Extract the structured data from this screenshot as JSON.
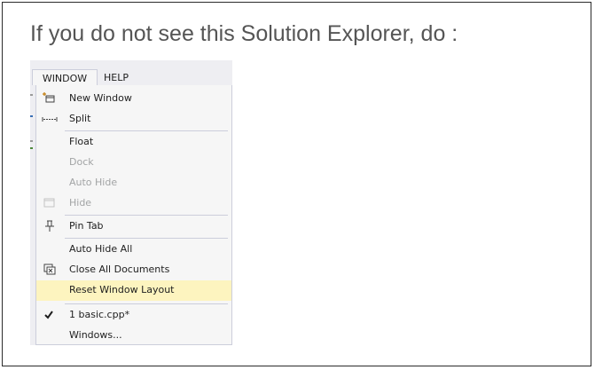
{
  "instruction": "If you do not see this Solution Explorer, do :",
  "menubar": {
    "window_label": "WINDOW",
    "help_label": "HELP"
  },
  "menu": {
    "items": [
      {
        "label": "New Window",
        "icon": "new-window-icon",
        "enabled": true
      },
      {
        "label": "Split",
        "icon": "split-icon",
        "enabled": true
      },
      {
        "label": "Float",
        "enabled": true
      },
      {
        "label": "Dock",
        "enabled": false
      },
      {
        "label": "Auto Hide",
        "enabled": false
      },
      {
        "label": "Hide",
        "icon": "hide-icon",
        "enabled": false
      },
      {
        "label": "Pin Tab",
        "icon": "pin-icon",
        "enabled": true
      },
      {
        "label": "Auto Hide All",
        "enabled": true
      },
      {
        "label": "Close All Documents",
        "icon": "close-all-documents-icon",
        "enabled": true
      },
      {
        "label": "Reset Window Layout",
        "enabled": true,
        "highlighted": true
      },
      {
        "label": "1 basic.cpp*",
        "icon": "checkmark-icon",
        "enabled": true,
        "checked": true
      },
      {
        "label": "Windows...",
        "enabled": true
      }
    ]
  },
  "colors": {
    "highlight": "#fdf4bf",
    "menu_background": "#f6f6f6",
    "menubar_background": "#eeeef2",
    "disabled_text": "#a2a4a5",
    "instruction_text": "#555555"
  }
}
